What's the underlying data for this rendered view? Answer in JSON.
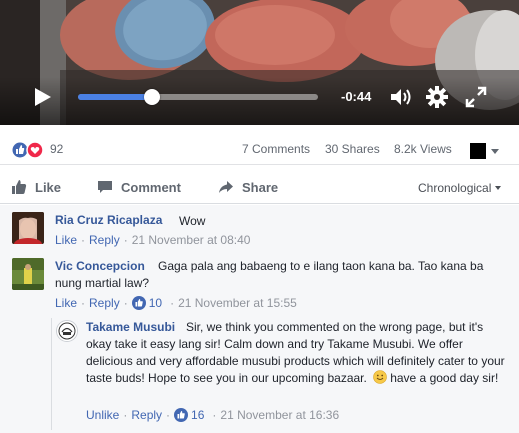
{
  "video": {
    "time_remaining": "-0:44",
    "progress": 0.31
  },
  "stats": {
    "reaction_count": "92",
    "comments": "7 Comments",
    "shares": "30 Shares",
    "views": "8.2k Views"
  },
  "actions": {
    "like": "Like",
    "comment": "Comment",
    "share": "Share",
    "sort": "Chronological"
  },
  "comments": [
    {
      "name": "Ria Cruz Ricaplaza",
      "text": "Wow",
      "like": "Like",
      "reply": "Reply",
      "time": "21 November at 08:40"
    },
    {
      "name": "Vic Concepcion",
      "text": "Gaga pala ang babaeng to e ilang taon kana ba. Tao kana ba nung martial law?",
      "like": "Like",
      "reply": "Reply",
      "likes": "10",
      "time": "21 November at 15:55"
    }
  ],
  "reply": {
    "name": "Takame Musubi",
    "text": "Sir, we think you commented on the wrong page, but it's okay take it easy lang sir! Calm down and try Takame Musubi. We offer delicious and very affordable musubi products which will definitely cater to your taste buds! Hope to see you in our upcoming bazaar.",
    "text_end": "have a good day sir!",
    "emoji": "smiley-emoji-icon",
    "like": "Unlike",
    "reply": "Reply",
    "likes": "16",
    "time": "21 November at 16:36"
  },
  "colors": {
    "link": "#365899",
    "accent": "#4267b2",
    "seek": "#4a80e4",
    "meta": "#90949c"
  }
}
